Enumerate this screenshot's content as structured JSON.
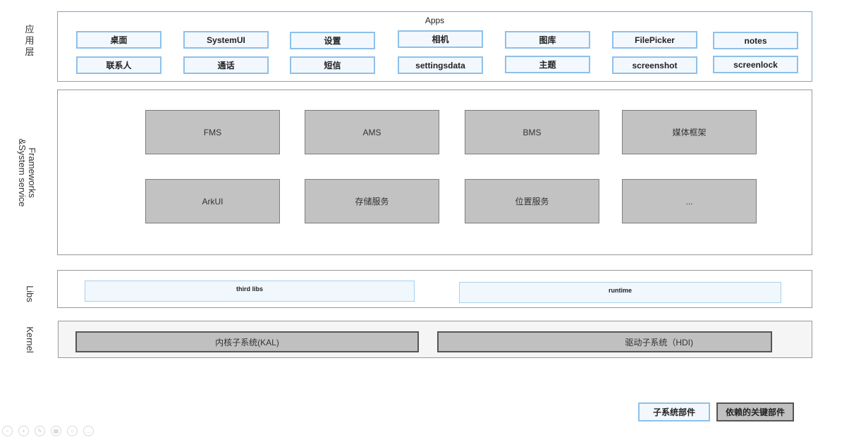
{
  "layers": {
    "apps": {
      "side_label": "应\n用\n层",
      "title": "Apps",
      "row1": [
        "桌面",
        "SystemUI",
        "设置",
        "相机",
        "图库",
        "FilePicker",
        "notes"
      ],
      "row2": [
        "联系人",
        "通话",
        "短信",
        "settingsdata",
        "主题",
        "screenshot",
        "screenlock"
      ]
    },
    "frameworks": {
      "side_label_line1": "Frameworks",
      "side_label_line2": "&System service",
      "row1": [
        "FMS",
        "AMS",
        "BMS",
        "媒体框架"
      ],
      "row2": [
        "ArkUI",
        "存储服务",
        "位置服务",
        "..."
      ]
    },
    "libs": {
      "side_label": "Libs",
      "items": [
        "third libs",
        "runtime"
      ]
    },
    "kernel": {
      "side_label": "Kernel",
      "items": [
        "内核子系统(KAL)",
        "驱动子系统（HDI)"
      ]
    }
  },
  "legend": {
    "subsystem": "子系统部件",
    "dependency": "依赖的关键部件"
  },
  "colors": {
    "app_border": "#8ec0ea",
    "app_fill": "#f2f8fe",
    "service_fill": "#c2c2c2",
    "kernel_fill": "#c0c0c0",
    "layer_border": "#999999",
    "apps_layer_border": "#6fa8dc"
  },
  "toolbar": {
    "icons": [
      "zoom-out-icon",
      "zoom-in-icon",
      "edit-icon",
      "layout-icon",
      "search-icon",
      "more-icon"
    ]
  }
}
